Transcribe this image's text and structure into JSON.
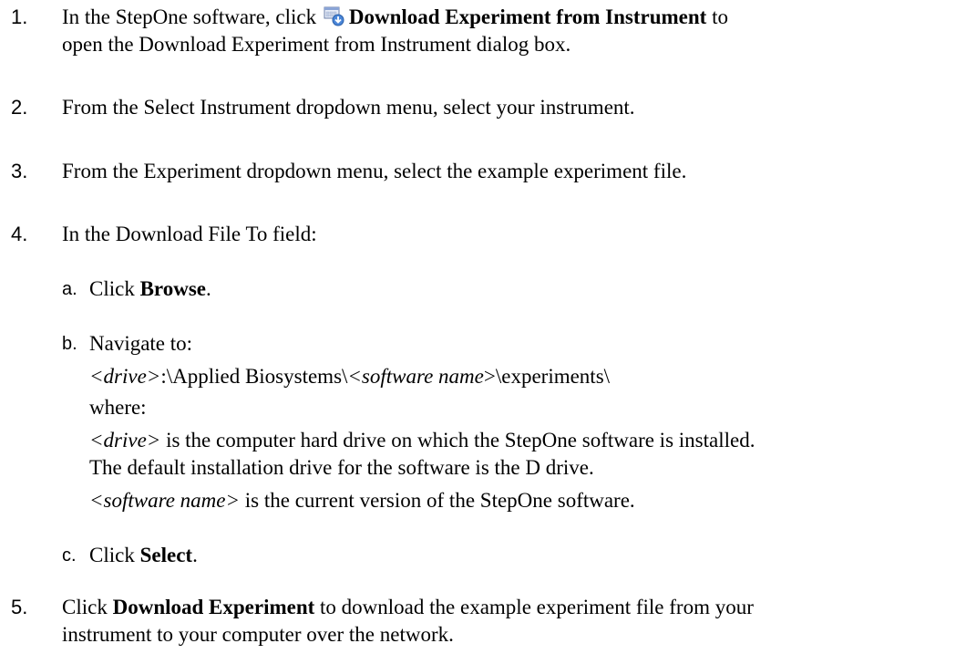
{
  "steps": [
    {
      "num": "1.",
      "pre": "In the StepOne software, click ",
      "icon": "download-experiment-icon",
      "bold": "Download Experiment from Instrument",
      "post": " to",
      "line2": "open the Download Experiment from Instrument dialog box."
    },
    {
      "num": "2.",
      "text": "From the Select Instrument dropdown menu, select your instrument."
    },
    {
      "num": "3.",
      "text": "From the Experiment dropdown menu, select the example experiment file."
    },
    {
      "num": "4.",
      "text": "In the Download File To field:",
      "substeps": [
        {
          "num": "a.",
          "pre": "Click ",
          "bold": "Browse",
          "post": "."
        },
        {
          "num": "b.",
          "text": "Navigate to:",
          "path_drive": "<drive>",
          "path_mid": ":\\Applied Biosystems\\",
          "path_software": "<software name>",
          "path_end": ">\\experiments\\",
          "where": "where:",
          "drive_term": "<drive>",
          "drive_desc": " is the computer hard drive on which the StepOne software is installed.",
          "drive_desc2": "The default installation drive for the software is the D drive.",
          "sw_term": "<software name>",
          "sw_desc": " is the current version of the StepOne software."
        },
        {
          "num": "c.",
          "pre": "Click ",
          "bold": "Select",
          "post": "."
        }
      ]
    },
    {
      "num": "5.",
      "pre": "Click ",
      "bold": "Download Experiment",
      "post": " to download the example experiment file from your",
      "line2": "instrument to your computer over the network."
    }
  ]
}
